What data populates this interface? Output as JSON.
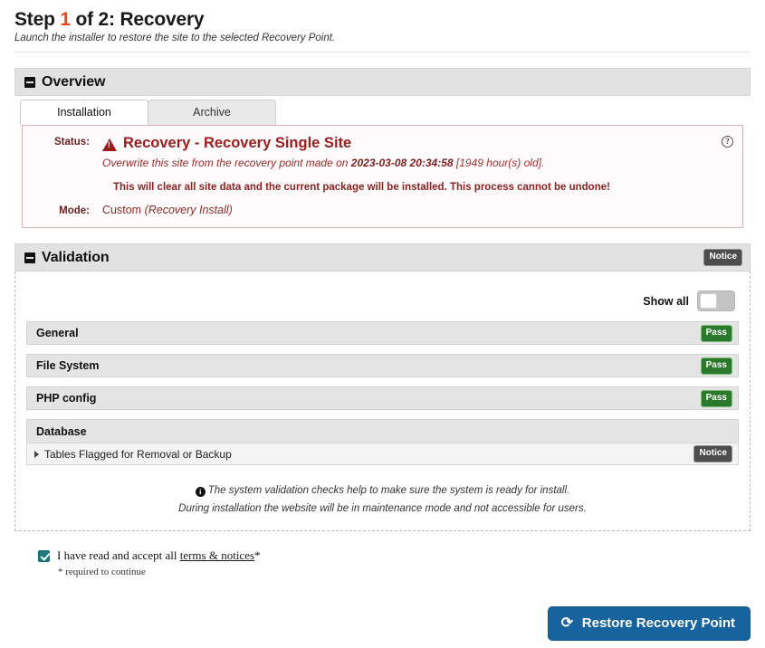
{
  "header": {
    "title_prefix": "Step",
    "step_number": "1",
    "title_suffix": "of 2: Recovery",
    "subtitle": "Launch the installer to restore the site to the selected Recovery Point."
  },
  "overview": {
    "section_title": "Overview",
    "collapse_icon": "minus-square-icon",
    "tabs": [
      {
        "label": "Installation",
        "active": true
      },
      {
        "label": "Archive",
        "active": false
      }
    ],
    "help_icon": "help-circle-icon",
    "status": {
      "label": "Status:",
      "warning_icon": "warning-triangle-icon",
      "title": "Recovery - Recovery Single Site",
      "desc_prefix": "Overwrite this site from the recovery point made on",
      "desc_timestamp": "2023-03-08 20:34:58",
      "desc_suffix": "[1949 hour(s) old].",
      "warning_text": "This will clear all site data and the current package will be installed. This process cannot be undone!"
    },
    "mode": {
      "label": "Mode:",
      "value": "Custom",
      "value_note": "(Recovery Install)"
    }
  },
  "validation": {
    "section_title": "Validation",
    "collapse_icon": "minus-square-icon",
    "header_badge": "Notice",
    "show_all_label": "Show all",
    "show_all_toggle_state": "off",
    "rows": [
      {
        "name": "General",
        "badge": "Pass",
        "badge_type": "pass"
      },
      {
        "name": "File System",
        "badge": "Pass",
        "badge_type": "pass"
      },
      {
        "name": "PHP config",
        "badge": "Pass",
        "badge_type": "pass"
      },
      {
        "name": "Database",
        "badge": "",
        "badge_type": "none"
      }
    ],
    "database_subrow": {
      "caret_icon": "caret-right-icon",
      "name": "Tables Flagged for Removal or Backup",
      "badge": "Notice"
    },
    "note_icon": "info-circle-icon",
    "note_line1": "The system validation checks help to make sure the system is ready for install.",
    "note_line2": "During installation the website will be in maintenance mode and not accessible for users."
  },
  "accept": {
    "checkbox_state": "checked",
    "text_before": "I have read and accept all",
    "link_text": "terms & notices",
    "asterisk": "*",
    "required_note": "* required to continue"
  },
  "footer": {
    "restore_icon": "rotate-ccw-icon",
    "restore_label": "Restore Recovery Point"
  },
  "colors": {
    "accent_step": "#e8491d",
    "status_red": "#9b1c1c",
    "pass_green": "#2b7a2b",
    "notice_grey": "#4d4d4d",
    "button_blue": "#17639e",
    "checkbox_teal": "#1d7a7a"
  }
}
